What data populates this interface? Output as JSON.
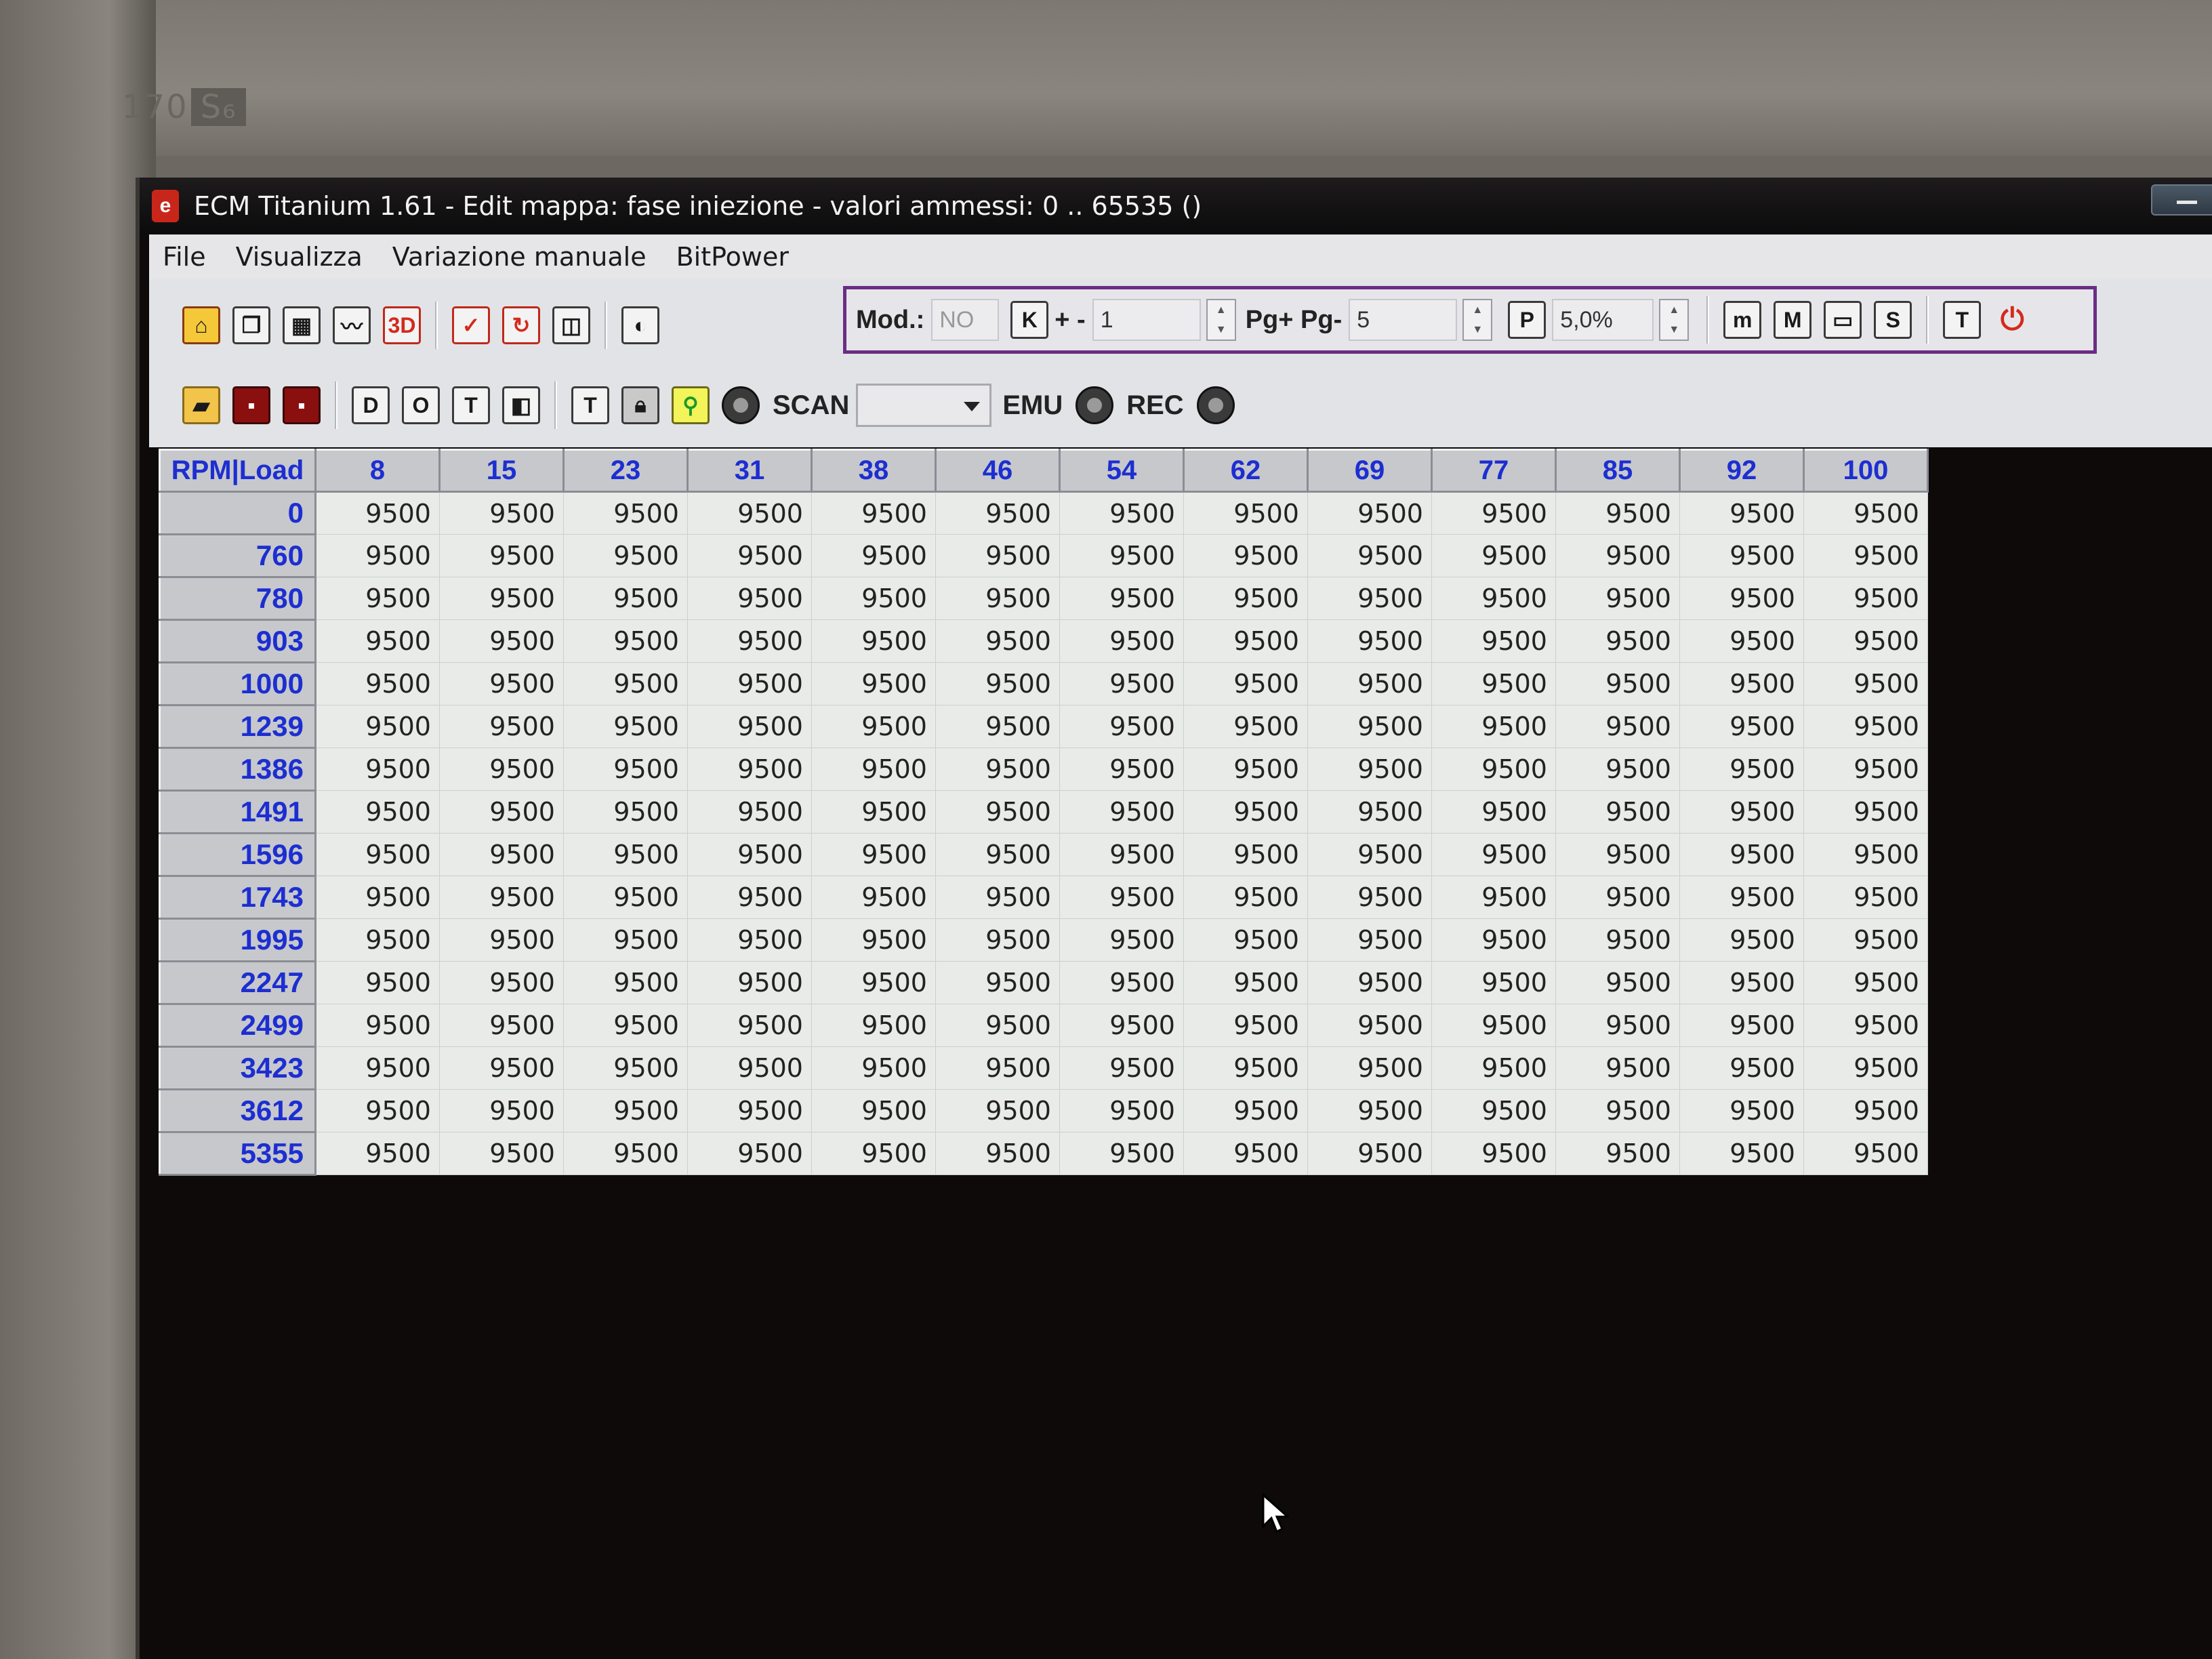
{
  "bezel": {
    "model": "170",
    "model_suffix": "S₆"
  },
  "window": {
    "app_icon": "ecm-app-icon",
    "title": "ECM Titanium 1.61 - Edit mappa: fase iniezione - valori ammessi: 0 .. 65535 ()"
  },
  "menu": [
    "File",
    "Visualizza",
    "Variazione manuale",
    "BitPower"
  ],
  "toolbar": {
    "mod_label": "Mod.:",
    "mod_value": "NO",
    "plusminus_label": "+ -",
    "plusminus_value": "1",
    "pg_label": "Pg+ Pg-",
    "pg_value": "5",
    "percent_value": "5,0%",
    "scan_label": "SCAN",
    "scan_value": "",
    "emu_label": "EMU",
    "rec_label": "REC",
    "icon_3d": "3D",
    "icon_k": "K",
    "icon_p": "P",
    "icon_m": "m",
    "icon_M": "M",
    "icon_S": "S",
    "icon_T": "T"
  },
  "table": {
    "corner": "RPM|Load",
    "columns": [
      "8",
      "15",
      "23",
      "31",
      "38",
      "46",
      "54",
      "62",
      "69",
      "77",
      "85",
      "92",
      "100"
    ],
    "rows": [
      {
        "rpm": "0",
        "values": [
          "9500",
          "9500",
          "9500",
          "9500",
          "9500",
          "9500",
          "9500",
          "9500",
          "9500",
          "9500",
          "9500",
          "9500",
          "9500"
        ]
      },
      {
        "rpm": "760",
        "values": [
          "9500",
          "9500",
          "9500",
          "9500",
          "9500",
          "9500",
          "9500",
          "9500",
          "9500",
          "9500",
          "9500",
          "9500",
          "9500"
        ]
      },
      {
        "rpm": "780",
        "values": [
          "9500",
          "9500",
          "9500",
          "9500",
          "9500",
          "9500",
          "9500",
          "9500",
          "9500",
          "9500",
          "9500",
          "9500",
          "9500"
        ]
      },
      {
        "rpm": "903",
        "values": [
          "9500",
          "9500",
          "9500",
          "9500",
          "9500",
          "9500",
          "9500",
          "9500",
          "9500",
          "9500",
          "9500",
          "9500",
          "9500"
        ]
      },
      {
        "rpm": "1000",
        "values": [
          "9500",
          "9500",
          "9500",
          "9500",
          "9500",
          "9500",
          "9500",
          "9500",
          "9500",
          "9500",
          "9500",
          "9500",
          "9500"
        ]
      },
      {
        "rpm": "1239",
        "values": [
          "9500",
          "9500",
          "9500",
          "9500",
          "9500",
          "9500",
          "9500",
          "9500",
          "9500",
          "9500",
          "9500",
          "9500",
          "9500"
        ]
      },
      {
        "rpm": "1386",
        "values": [
          "9500",
          "9500",
          "9500",
          "9500",
          "9500",
          "9500",
          "9500",
          "9500",
          "9500",
          "9500",
          "9500",
          "9500",
          "9500"
        ]
      },
      {
        "rpm": "1491",
        "values": [
          "9500",
          "9500",
          "9500",
          "9500",
          "9500",
          "9500",
          "9500",
          "9500",
          "9500",
          "9500",
          "9500",
          "9500",
          "9500"
        ]
      },
      {
        "rpm": "1596",
        "values": [
          "9500",
          "9500",
          "9500",
          "9500",
          "9500",
          "9500",
          "9500",
          "9500",
          "9500",
          "9500",
          "9500",
          "9500",
          "9500"
        ]
      },
      {
        "rpm": "1743",
        "values": [
          "9500",
          "9500",
          "9500",
          "9500",
          "9500",
          "9500",
          "9500",
          "9500",
          "9500",
          "9500",
          "9500",
          "9500",
          "9500"
        ]
      },
      {
        "rpm": "1995",
        "values": [
          "9500",
          "9500",
          "9500",
          "9500",
          "9500",
          "9500",
          "9500",
          "9500",
          "9500",
          "9500",
          "9500",
          "9500",
          "9500"
        ]
      },
      {
        "rpm": "2247",
        "values": [
          "9500",
          "9500",
          "9500",
          "9500",
          "9500",
          "9500",
          "9500",
          "9500",
          "9500",
          "9500",
          "9500",
          "9500",
          "9500"
        ]
      },
      {
        "rpm": "2499",
        "values": [
          "9500",
          "9500",
          "9500",
          "9500",
          "9500",
          "9500",
          "9500",
          "9500",
          "9500",
          "9500",
          "9500",
          "9500",
          "9500"
        ]
      },
      {
        "rpm": "3423",
        "values": [
          "9500",
          "9500",
          "9500",
          "9500",
          "9500",
          "9500",
          "9500",
          "9500",
          "9500",
          "9500",
          "9500",
          "9500",
          "9500"
        ]
      },
      {
        "rpm": "3612",
        "values": [
          "9500",
          "9500",
          "9500",
          "9500",
          "9500",
          "9500",
          "9500",
          "9500",
          "9500",
          "9500",
          "9500",
          "9500",
          "9500"
        ]
      },
      {
        "rpm": "5355",
        "values": [
          "9500",
          "9500",
          "9500",
          "9500",
          "9500",
          "9500",
          "9500",
          "9500",
          "9500",
          "9500",
          "9500",
          "9500",
          "9500"
        ]
      }
    ]
  },
  "colors": {
    "header_text": "#1d2ed1",
    "group_border": "#6a2d84",
    "screen_bg": "#0d0a09"
  }
}
